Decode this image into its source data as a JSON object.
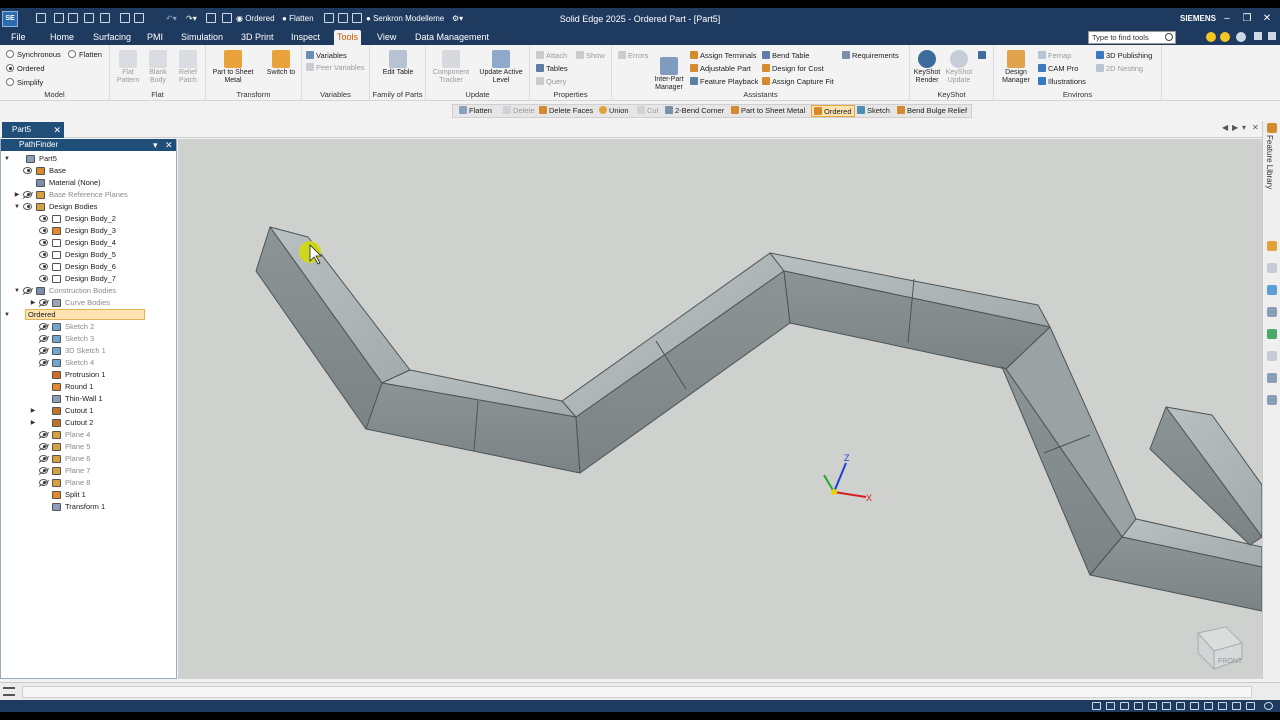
{
  "titlebar": {
    "app_title": "Solid Edge 2025 - Ordered Part - [Part5]",
    "brand": "SIEMENS",
    "logo": "SE",
    "mode_ordered": "Ordered",
    "mode_flatten": "Flatten",
    "mode_sync": "Senkron Modelleme",
    "window_controls": [
      "minimize-icon",
      "restore-icon",
      "close-icon"
    ]
  },
  "menu": {
    "tabs": [
      "File",
      "Home",
      "Surfacing",
      "PMI",
      "Simulation",
      "3D Print",
      "Inspect",
      "Tools",
      "View",
      "Data Management"
    ],
    "active_tab": "Tools",
    "search_placeholder": "Type to find tools"
  },
  "ribbon": {
    "model_group": {
      "label": "Model",
      "options": [
        "Synchronous",
        "Flatten",
        "Ordered",
        "Simplify"
      ],
      "selected": "Ordered"
    },
    "flat_group": {
      "label": "Flat",
      "buttons": [
        "Flat Pattern",
        "Blank Body",
        "Relief Patch"
      ]
    },
    "transform_group": {
      "label": "Transform",
      "buttons": [
        "Part to Sheet Metal",
        "Switch to"
      ]
    },
    "variables_group": {
      "label": "Variables",
      "items": [
        "Variables",
        "Peer Variables"
      ]
    },
    "family_group": {
      "label": "Family of Parts",
      "button": "Edit Table"
    },
    "update_group": {
      "label": "Update",
      "buttons": [
        "Component Tracker",
        "Update Active Level"
      ]
    },
    "properties_group": {
      "label": "Properties",
      "items": [
        "Attach",
        "Show",
        "Tables",
        "Query"
      ]
    },
    "assistants_group": {
      "label": "Assistants",
      "errors": "Errors",
      "inter_part": "Inter-Part Manager",
      "items": [
        "Assign Terminals",
        "Adjustable Part",
        "Feature Playback",
        "Bend Table",
        "Design for Cost",
        "Assign Capture Fit",
        "Requirements"
      ]
    },
    "keyshot_group": {
      "label": "KeyShot",
      "buttons": [
        "KeyShot Render",
        "KeyShot Update"
      ]
    },
    "environs_group": {
      "label": "Environs",
      "design_manager": "Design Manager",
      "items": [
        "Femap",
        "CAM Pro",
        "Illustrations",
        "3D Publishing",
        "2D Nesting"
      ]
    }
  },
  "command_bar": {
    "items": [
      "Flatten",
      "Delete",
      "Delete Faces",
      "Union",
      "Cut",
      "2-Bend Corner",
      "Part to Sheet Metal",
      "Ordered",
      "Sketch",
      "Bend Bulge Relief"
    ],
    "active": "Ordered"
  },
  "document_tab": {
    "name": "Part5"
  },
  "pathfinder": {
    "title": "PathFinder",
    "tree": [
      {
        "label": "Part5",
        "level": 0,
        "expander": "open",
        "icon": "part-icon",
        "dim": false
      },
      {
        "label": "Base",
        "level": 1,
        "eye": "on",
        "icon": "base-icon",
        "dim": false
      },
      {
        "label": "Material (None)",
        "level": 1,
        "icon": "material-icon",
        "dim": false
      },
      {
        "label": "Base Reference Planes",
        "level": 1,
        "expander": "closed",
        "eye": "off",
        "icon": "planes-icon",
        "dim": true
      },
      {
        "label": "Design Bodies",
        "level": 1,
        "expander": "open",
        "eye": "on",
        "icon": "bodies-icon",
        "dim": false
      },
      {
        "label": "Design Body_2",
        "level": 2,
        "eye": "on",
        "icon": "body-icon",
        "dim": false
      },
      {
        "label": "Design Body_3",
        "level": 2,
        "eye": "on",
        "icon": "body-solid-icon",
        "dim": false
      },
      {
        "label": "Design Body_4",
        "level": 2,
        "eye": "on",
        "icon": "body-icon",
        "dim": false
      },
      {
        "label": "Design Body_5",
        "level": 2,
        "eye": "on",
        "icon": "body-icon",
        "dim": false
      },
      {
        "label": "Design Body_6",
        "level": 2,
        "eye": "on",
        "icon": "body-icon",
        "dim": false
      },
      {
        "label": "Design Body_7",
        "level": 2,
        "eye": "on",
        "icon": "body-icon",
        "dim": false
      },
      {
        "label": "Construction Bodies",
        "level": 1,
        "expander": "open",
        "eye": "off",
        "icon": "construction-icon",
        "dim": true
      },
      {
        "label": "Curve Bodies",
        "level": 2,
        "expander": "closed",
        "eye": "off",
        "icon": "curve-icon",
        "dim": true
      },
      {
        "label": "Ordered",
        "level": 0,
        "expander": "open",
        "icon": "",
        "dim": false,
        "selected": true
      },
      {
        "label": "Sketch 2",
        "level": 2,
        "eye": "off",
        "icon": "sketch-icon",
        "dim": true
      },
      {
        "label": "Sketch 3",
        "level": 2,
        "eye": "off",
        "icon": "sketch-icon",
        "dim": true
      },
      {
        "label": "3D Sketch 1",
        "level": 2,
        "eye": "off",
        "icon": "sketch3d-icon",
        "dim": true
      },
      {
        "label": "Sketch 4",
        "level": 2,
        "eye": "off",
        "icon": "sketch-icon",
        "dim": true
      },
      {
        "label": "Protrusion 1",
        "level": 2,
        "icon": "protrusion-icon",
        "dim": false
      },
      {
        "label": "Round 1",
        "level": 2,
        "icon": "round-icon",
        "dim": false
      },
      {
        "label": "Thin-Wall 1",
        "level": 2,
        "icon": "thinwall-icon",
        "dim": false
      },
      {
        "label": "Cutout 1",
        "level": 2,
        "expander": "closed",
        "icon": "cutout-icon",
        "dim": false
      },
      {
        "label": "Cutout 2",
        "level": 2,
        "expander": "closed",
        "icon": "cutout-icon",
        "dim": false
      },
      {
        "label": "Plane 4",
        "level": 2,
        "eye": "off",
        "icon": "plane-icon",
        "dim": true
      },
      {
        "label": "Plane 5",
        "level": 2,
        "eye": "off",
        "icon": "plane-icon",
        "dim": true
      },
      {
        "label": "Plane 6",
        "level": 2,
        "eye": "off",
        "icon": "plane-icon",
        "dim": true
      },
      {
        "label": "Plane 7",
        "level": 2,
        "eye": "off",
        "icon": "plane-icon",
        "dim": true
      },
      {
        "label": "Plane 8",
        "level": 2,
        "eye": "off",
        "icon": "plane-icon",
        "dim": true
      },
      {
        "label": "Split 1",
        "level": 2,
        "icon": "split-icon",
        "dim": false
      },
      {
        "label": "Transform 1",
        "level": 2,
        "icon": "transform-icon",
        "dim": false
      }
    ]
  },
  "viewport": {
    "triad": {
      "x": "X",
      "y": "Y",
      "z": "Z"
    },
    "view_cube_face": "FRONT"
  },
  "right_rail": {
    "title": "Feature Library"
  },
  "colors": {
    "title_bar": "#1f3a5f",
    "active_tab_text": "#c65a00",
    "viewport_bg": "#cfd1ce",
    "part_face": "#9ea5a6",
    "selection_highlight": "#fde3b0"
  }
}
